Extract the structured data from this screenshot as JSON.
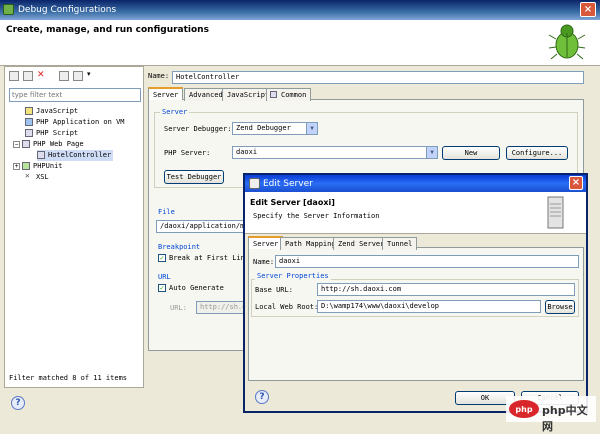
{
  "window": {
    "title": "Debug Configurations",
    "header": "Create, manage, and run configurations"
  },
  "sidebar": {
    "filter_placeholder": "type filter text",
    "items": [
      {
        "label": "JavaScript"
      },
      {
        "label": "PHP Application on VM"
      },
      {
        "label": "PHP Script"
      },
      {
        "label": "PHP Web Page"
      },
      {
        "label": "HotelController"
      },
      {
        "label": "PHPUnit"
      },
      {
        "label": "XSL"
      }
    ],
    "status": "Filter matched 8 of 11 items"
  },
  "config": {
    "name_label": "Name:",
    "name_value": "HotelController",
    "tabs": [
      "Server",
      "Advanced",
      "JavaScript",
      "Common"
    ],
    "server_group": "Server",
    "debugger_label": "Server Debugger:",
    "debugger_value": "Zend Debugger",
    "php_server_label": "PHP Server:",
    "php_server_value": "daoxi",
    "new_button": "New",
    "configure_button": "Configure...",
    "test_button": "Test Debugger",
    "file_group": "File",
    "file_value": "/daoxi/application/mo",
    "breakpoint_group": "Breakpoint",
    "break_first_line": "Break at First Line",
    "url_group": "URL",
    "auto_generate": "Auto Generate",
    "url_label": "URL:",
    "url_value": "http://sh.da"
  },
  "dialog": {
    "title": "Edit Server",
    "heading": "Edit Server [daoxi]",
    "subheading": "Specify the Server Information",
    "tabs": [
      "Server",
      "Path Mapping",
      "Zend Server",
      "Tunnel"
    ],
    "name_label": "Name:",
    "name_value": "daoxi",
    "props_group": "Server Properties",
    "base_url_label": "Base URL:",
    "base_url_value": "http://sh.daoxi.com",
    "web_root_label": "Local Web Root:",
    "web_root_value": "D:\\wamp174\\www\\daoxi\\develop",
    "browse_button": "Browse",
    "ok_button": "OK",
    "cancel_button": "Cancel"
  },
  "watermark": {
    "text": "php中文网"
  }
}
